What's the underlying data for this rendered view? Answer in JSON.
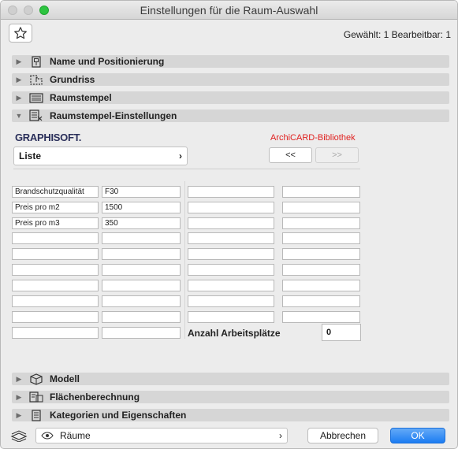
{
  "window": {
    "title": "Einstellungen für die Raum-Auswahl"
  },
  "header": {
    "selection_info": "Gewählt: 1 Bearbeitbar: 1",
    "favorites_icon": "star-icon"
  },
  "sections_top": [
    {
      "label": "Name und Positionierung",
      "expanded": false,
      "icon": "name-position-icon"
    },
    {
      "label": "Grundriss",
      "expanded": false,
      "icon": "floorplan-icon"
    },
    {
      "label": "Raumstempel",
      "expanded": false,
      "icon": "zone-stamp-icon"
    },
    {
      "label": "Raumstempel-Einstellungen",
      "expanded": true,
      "icon": "zone-stamp-settings-icon"
    }
  ],
  "stamp_settings": {
    "brand": "GRAPHISOFT.",
    "library": "ArchiCARD-Bibliothek",
    "list_label": "Liste",
    "prev_label": "<<",
    "next_label": ">>",
    "rows": [
      {
        "name": "Brandschutzqualität",
        "value": "F30"
      },
      {
        "name": "Preis pro m2",
        "value": "1500"
      },
      {
        "name": "Preis pro m3",
        "value": "350"
      }
    ],
    "workplaces_label": "Anzahl Arbeitsplätze",
    "workplaces_value": "0"
  },
  "sections_bottom": [
    {
      "label": "Modell",
      "expanded": false,
      "icon": "model-icon"
    },
    {
      "label": "Flächenberechnung",
      "expanded": false,
      "icon": "area-calc-icon"
    },
    {
      "label": "Kategorien und Eigenschaften",
      "expanded": false,
      "icon": "categories-icon"
    }
  ],
  "footer": {
    "layer_icon": "layers-icon",
    "layer_label": "Räume",
    "cancel_label": "Abbrechen",
    "ok_label": "OK"
  },
  "colors": {
    "ok_button": "#1c7cf2",
    "library_text": "#e0201f",
    "zoom_button": "#2dc440"
  }
}
